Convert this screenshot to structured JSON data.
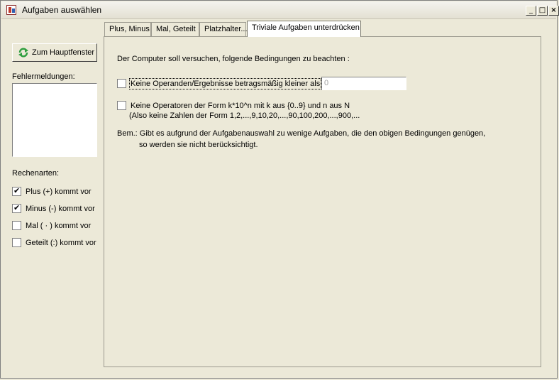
{
  "window": {
    "title": "Aufgaben auswählen",
    "buttons": {
      "minimize": "_",
      "maximize": "□",
      "close": "×"
    }
  },
  "sidebar": {
    "home_button_label": "Zum Hauptfenster",
    "errors_label": "Fehlermeldungen:",
    "operations_label": "Rechenarten:",
    "operations": [
      {
        "label": "Plus (+) kommt vor",
        "checked": true
      },
      {
        "label": "Minus (-) kommt vor",
        "checked": true
      },
      {
        "label": "Mal ( · ) kommt vor",
        "checked": false
      },
      {
        "label": "Geteilt (:) kommt vor",
        "checked": false
      }
    ]
  },
  "tabs": [
    {
      "label": "Plus, Minus",
      "active": false
    },
    {
      "label": "Mal, Geteilt",
      "active": false
    },
    {
      "label": "Platzhalter...",
      "active": false
    },
    {
      "label": "Triviale Aufgaben unterdrücken",
      "active": true
    }
  ],
  "content": {
    "intro": "Der Computer soll versuchen, folgende Bedingungen zu beachten :",
    "option1_label": "Keine Operanden/Ergebnisse betragsmäßig kleiner als",
    "option1_checked": false,
    "option1_value": "0",
    "option2_line1": "Keine Operatoren der Form k*10^n mit k aus {0..9} und n aus N",
    "option2_line2": "(Also keine Zahlen der Form 1,2,...,9,10,20,...,90,100,200,...,900,...",
    "option2_checked": false,
    "note_line1": "Bem.: Gibt es aufgrund der Aufgabenauswahl zu wenige Aufgaben, die den obigen Bedingungen genügen,",
    "note_line2": "so werden sie nicht berücksichtigt."
  }
}
